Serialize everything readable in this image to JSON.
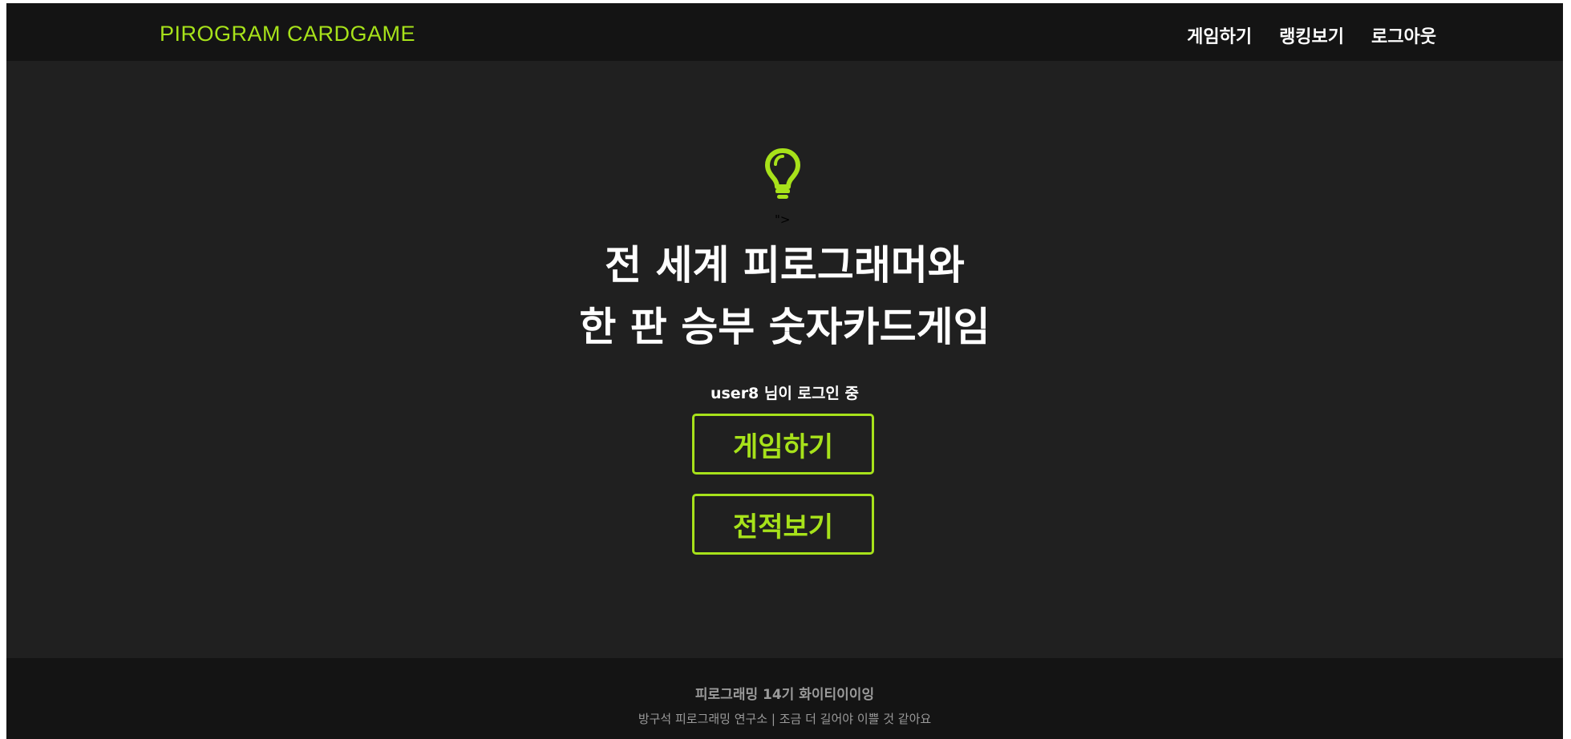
{
  "navbar": {
    "brand": "PIROGRAM CARDGAME",
    "links": [
      "게임하기",
      "랭킹보기",
      "로그아웃"
    ]
  },
  "hero": {
    "icon": "lightbulb-icon",
    "stray_text": "\">",
    "headline_line1": "전 세계 피로그래머와",
    "headline_line2": "한 판 승부 숫자카드게임",
    "login_status": "user8 님이 로그인 중",
    "play_button": "게임하기",
    "record_button": "전적보기"
  },
  "footer": {
    "title": "피로그래밍 14기 화이티이이잉",
    "subtitle": "방구석 피로그래밍 연구소 | 조금 더 길어야 이쁠 것 같아요"
  },
  "colors": {
    "accent": "#a7e21a",
    "background": "#202020",
    "navbar": "#141414"
  }
}
